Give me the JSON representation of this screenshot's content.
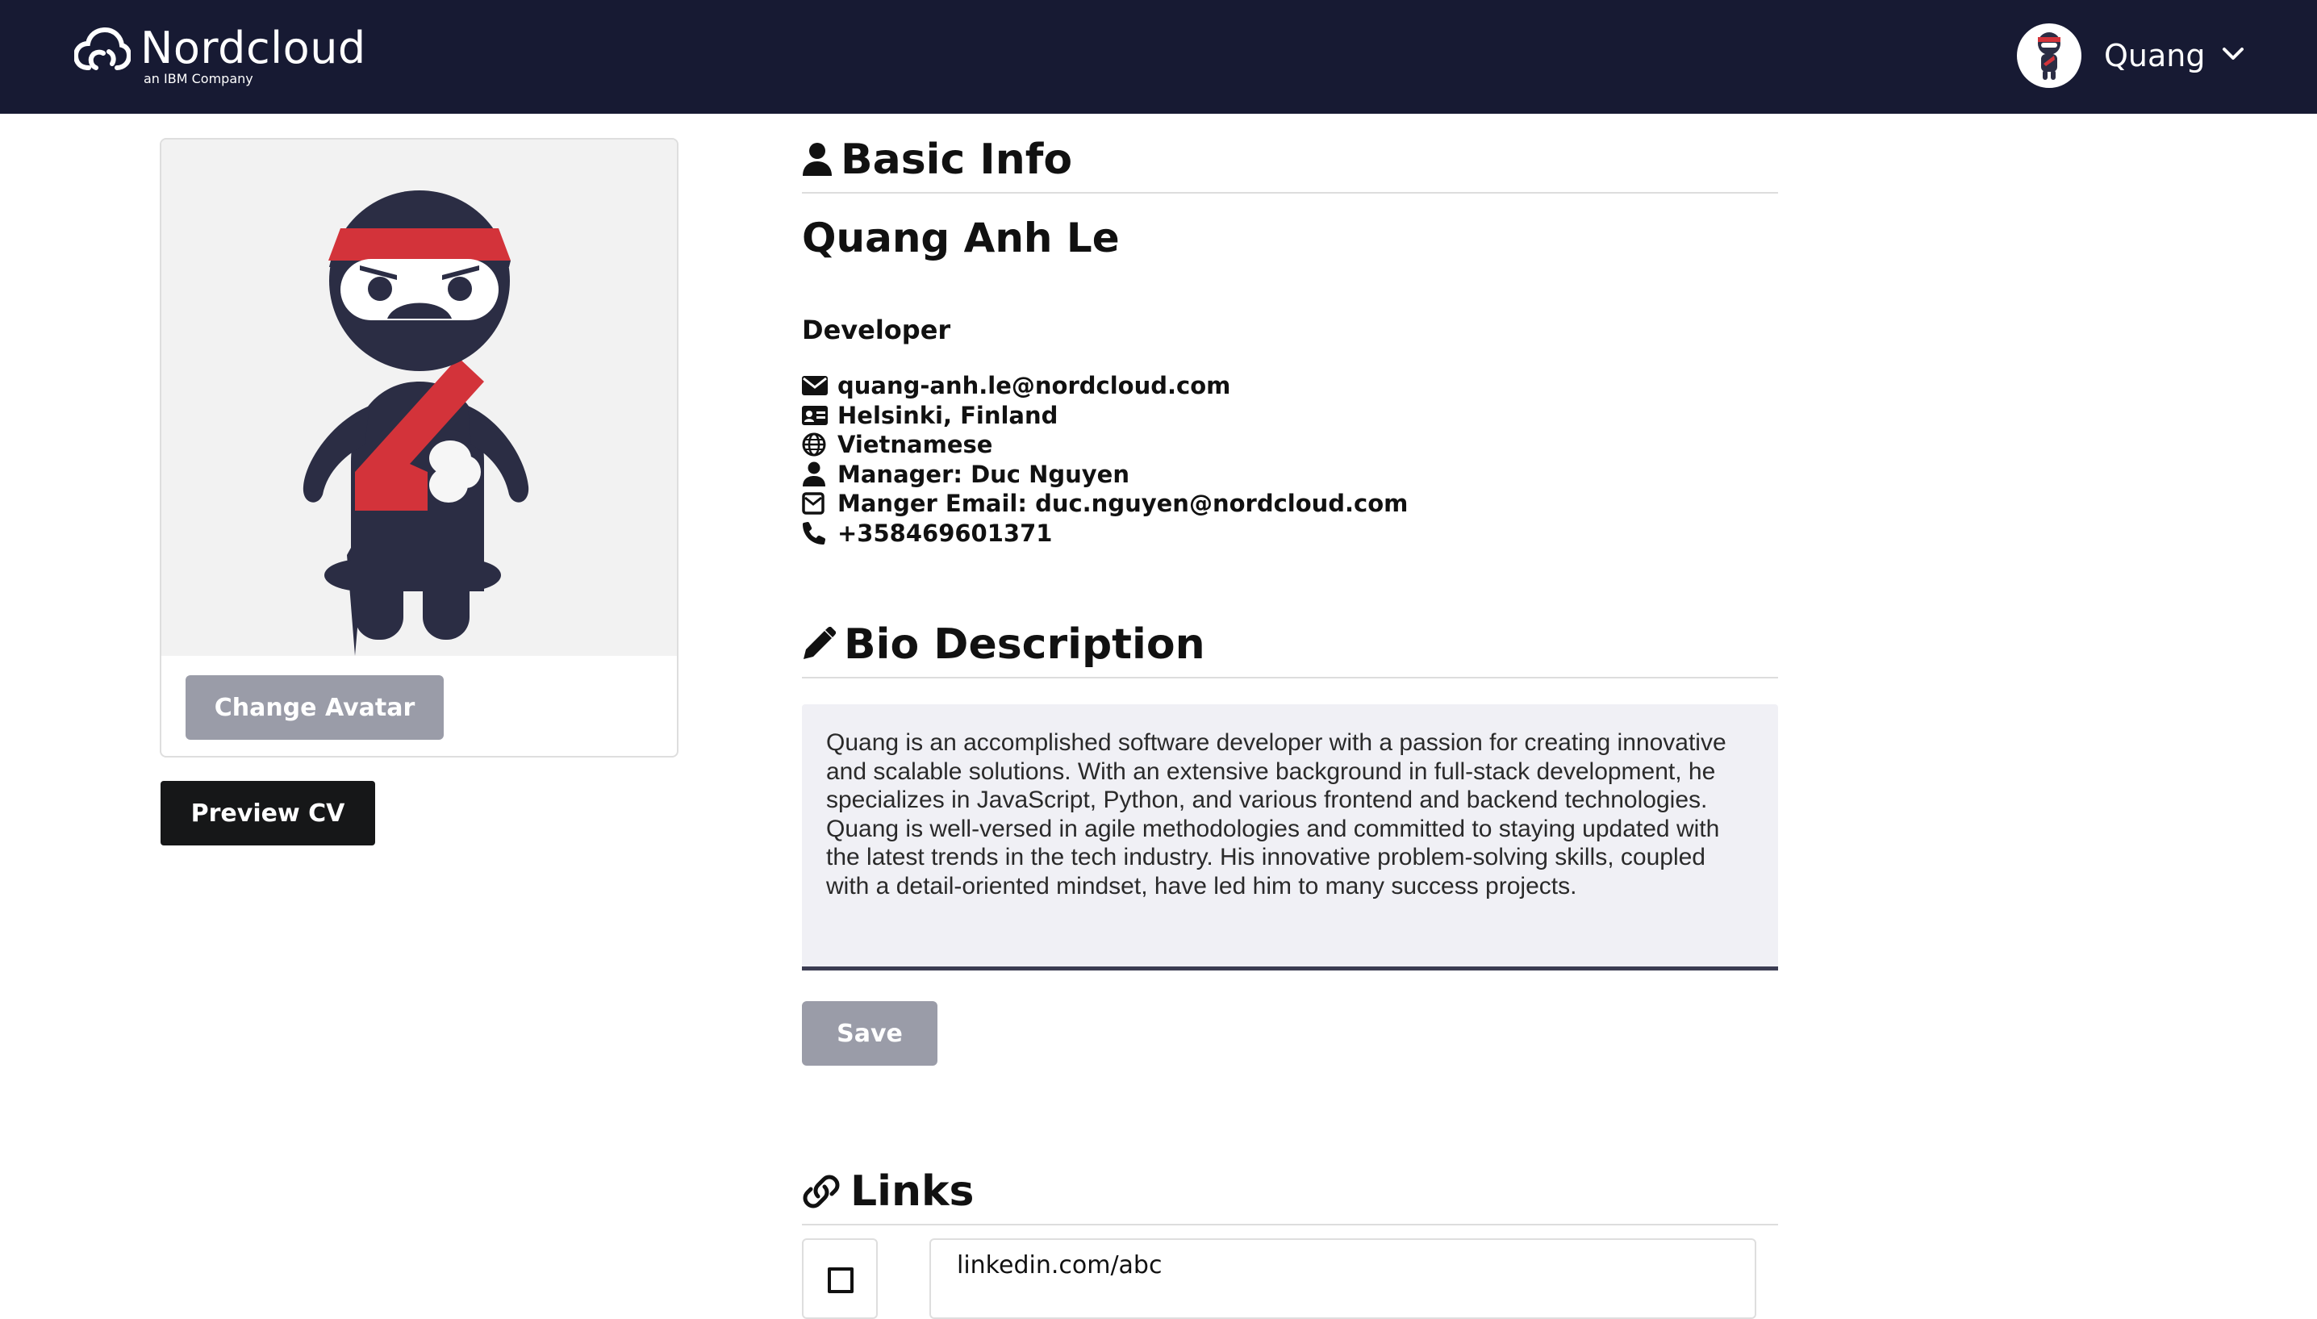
{
  "header": {
    "brand": "Nordcloud",
    "brand_sub": "an IBM Company",
    "user_name": "Quang"
  },
  "sidebar": {
    "change_avatar_label": "Change Avatar",
    "preview_cv_label": "Preview CV"
  },
  "basic_info": {
    "heading": "Basic Info",
    "full_name": "Quang Anh Le",
    "job_title": "Developer",
    "contacts": [
      {
        "icon": "envelope-icon",
        "text": "quang-anh.le@nordcloud.com"
      },
      {
        "icon": "id-card-icon",
        "text": "Helsinki, Finland"
      },
      {
        "icon": "globe-icon",
        "text": "Vietnamese"
      },
      {
        "icon": "user-icon",
        "text": "Manager: Duc Nguyen"
      },
      {
        "icon": "envelope-outline-icon",
        "text": "Manger Email: duc.nguyen@nordcloud.com"
      },
      {
        "icon": "phone-icon",
        "text": "+358469601371"
      }
    ]
  },
  "bio": {
    "heading": "Bio Description",
    "text": "Quang is an accomplished software developer with a passion for creating innovative and scalable solutions. With an extensive background in full-stack development, he specializes in JavaScript, Python, and various frontend and backend technologies. Quang is well-versed in agile methodologies and committed to staying updated with the latest trends in the tech industry. His innovative problem-solving skills, coupled with a detail-oriented mindset, have led him to many success projects.",
    "save_label": "Save"
  },
  "links": {
    "heading": "Links",
    "items": [
      {
        "checked": false,
        "value": "linkedin.com/abc"
      }
    ]
  },
  "colors": {
    "header_bg": "#171a33",
    "ninja_body": "#2b2d44",
    "ninja_band": "#d3333a",
    "button_grey": "#9a9ca8",
    "button_dark": "#161718",
    "bio_bg": "#f0f0f5"
  }
}
